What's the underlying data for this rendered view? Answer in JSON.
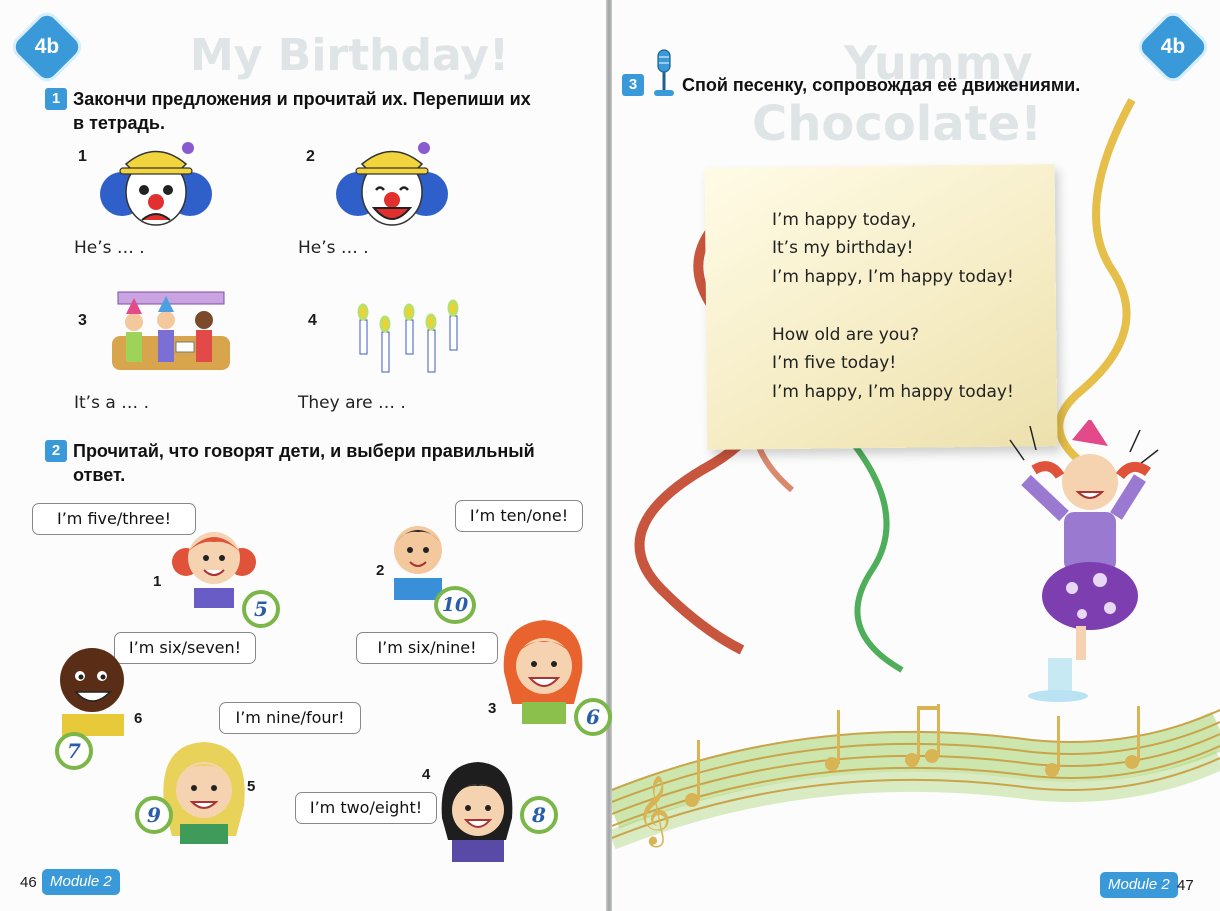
{
  "left_page": {
    "unit_badge": "4b",
    "ghost_title": "My Birthday!",
    "task1": {
      "number": "1",
      "title_line1": "Закончи предложения и прочитай их. Перепиши их",
      "title_line2": "в тетрадь.",
      "items": [
        {
          "num": "1",
          "sentence": "He’s … ."
        },
        {
          "num": "2",
          "sentence": "He’s … ."
        },
        {
          "num": "3",
          "sentence": "It’s a … ."
        },
        {
          "num": "4",
          "sentence": "They are … ."
        }
      ]
    },
    "task2": {
      "number": "2",
      "title_line1": "Прочитай, что говорят дети, и выбери правильный",
      "title_line2": "ответ.",
      "kids": [
        {
          "num": "1",
          "speech": "I’m five/three!",
          "age": "5"
        },
        {
          "num": "2",
          "speech": "I’m ten/one!",
          "age": "10"
        },
        {
          "num": "3",
          "speech": "I’m six/nine!",
          "age": "6"
        },
        {
          "num": "4",
          "speech": "I’m two/eight!",
          "age": "8"
        },
        {
          "num": "5",
          "speech": "I’m nine/four!",
          "age": "9"
        },
        {
          "num": "6",
          "speech": "I’m six/seven!",
          "age": "7"
        }
      ]
    },
    "footer": {
      "page_number": "46",
      "module": "Module 2"
    }
  },
  "right_page": {
    "unit_badge": "4b",
    "ghost_title_line1": "Yummy",
    "ghost_title_line2": "Chocolate!",
    "task3": {
      "number": "3",
      "title": "Спой песенку, сопровождая её движениями."
    },
    "song": {
      "verse1": [
        "I’m happy today,",
        "It’s my birthday!",
        "I’m happy, I’m happy today!"
      ],
      "verse2": [
        "How old are you?",
        "I’m five today!",
        "I’m happy, I’m happy today!"
      ]
    },
    "footer": {
      "page_number": "47",
      "module": "Module 2"
    }
  },
  "colors": {
    "accent_blue": "#3a9ad9",
    "circle_green": "#7ab648",
    "circle_text": "#2a5da8",
    "paper": "#f5ecc4",
    "ribbon_red": "#c8553d",
    "ribbon_gold": "#e6bf4a",
    "ribbon_green": "#4fae5a"
  },
  "icons": [
    "microphone-icon",
    "clown-sad-icon",
    "clown-happy-icon",
    "birthday-party-icon",
    "candles-icon",
    "music-notes-icon"
  ]
}
